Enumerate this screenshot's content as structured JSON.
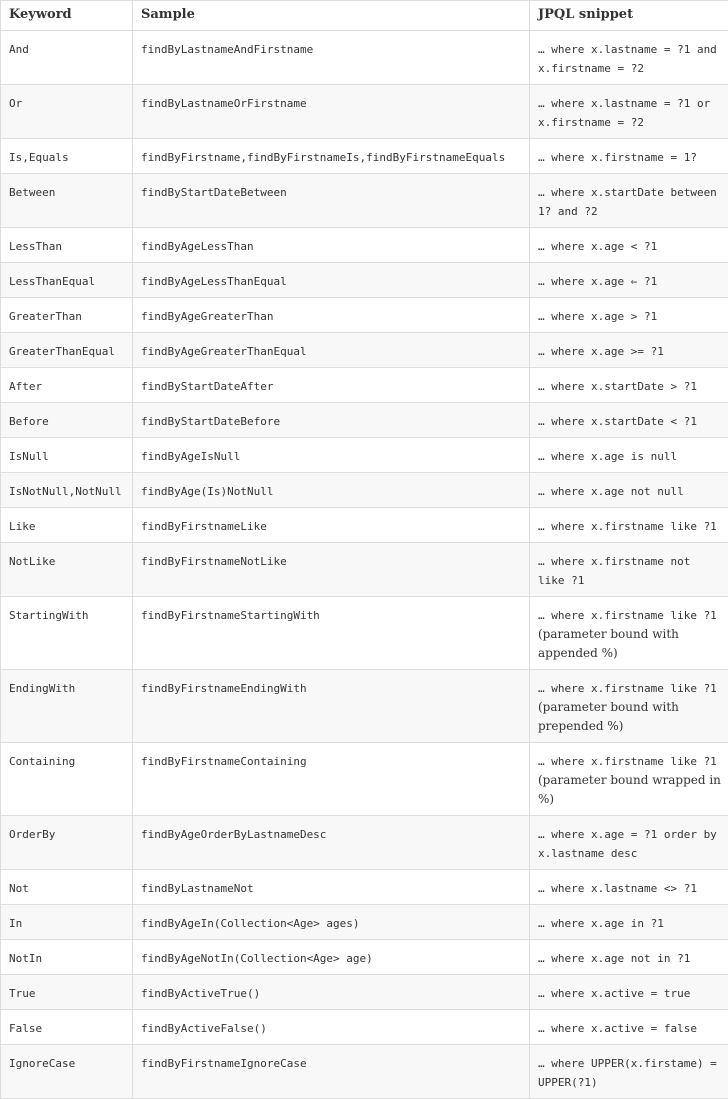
{
  "headers": {
    "keyword": "Keyword",
    "sample": "Sample",
    "jpql": "JPQL snippet"
  },
  "rows": [
    {
      "keyword": "And",
      "sample": "findByLastnameAndFirstname",
      "jpql": "… where x.lastname = ?1 and x.firstname = ?2"
    },
    {
      "keyword": "Or",
      "sample": "findByLastnameOrFirstname",
      "jpql": "… where x.lastname = ?1 or x.firstname = ?2"
    },
    {
      "keyword": "Is,Equals",
      "sample": "findByFirstname,findByFirstnameIs,findByFirstnameEquals",
      "jpql": "… where x.firstname = 1?"
    },
    {
      "keyword": "Between",
      "sample": "findByStartDateBetween",
      "jpql": "… where x.startDate between 1? and ?2"
    },
    {
      "keyword": "LessThan",
      "sample": "findByAgeLessThan",
      "jpql": "… where x.age < ?1"
    },
    {
      "keyword": "LessThanEqual",
      "sample": "findByAgeLessThanEqual",
      "jpql": "… where x.age ⇐ ?1"
    },
    {
      "keyword": "GreaterThan",
      "sample": "findByAgeGreaterThan",
      "jpql": "… where x.age > ?1"
    },
    {
      "keyword": "GreaterThanEqual",
      "sample": "findByAgeGreaterThanEqual",
      "jpql": "… where x.age >= ?1"
    },
    {
      "keyword": "After",
      "sample": "findByStartDateAfter",
      "jpql": "… where x.startDate > ?1"
    },
    {
      "keyword": "Before",
      "sample": "findByStartDateBefore",
      "jpql": "… where x.startDate < ?1"
    },
    {
      "keyword": "IsNull",
      "sample": "findByAgeIsNull",
      "jpql": "… where x.age is null"
    },
    {
      "keyword": "IsNotNull,NotNull",
      "sample": "findByAge(Is)NotNull",
      "jpql": "… where x.age not null"
    },
    {
      "keyword": "Like",
      "sample": "findByFirstnameLike",
      "jpql": "… where x.firstname like ?1"
    },
    {
      "keyword": "NotLike",
      "sample": "findByFirstnameNotLike",
      "jpql": "… where x.firstname not like ?1"
    },
    {
      "keyword": "StartingWith",
      "sample": "findByFirstnameStartingWith",
      "jpql": "… where x.firstname like ?1",
      "note": "(parameter bound with appended %)"
    },
    {
      "keyword": "EndingWith",
      "sample": "findByFirstnameEndingWith",
      "jpql": "… where x.firstname like ?1",
      "note": "(parameter bound with prepended %)"
    },
    {
      "keyword": "Containing",
      "sample": "findByFirstnameContaining",
      "jpql": "… where x.firstname like ?1",
      "note": "(parameter bound wrapped in %)"
    },
    {
      "keyword": "OrderBy",
      "sample": "findByAgeOrderByLastnameDesc",
      "jpql": "… where x.age = ?1 order by x.lastname desc"
    },
    {
      "keyword": "Not",
      "sample": "findByLastnameNot",
      "jpql": "… where x.lastname <> ?1"
    },
    {
      "keyword": "In",
      "sample": "findByAgeIn(Collection<Age> ages)",
      "jpql": "… where x.age in ?1"
    },
    {
      "keyword": "NotIn",
      "sample": "findByAgeNotIn(Collection<Age> age)",
      "jpql": "… where x.age not in ?1"
    },
    {
      "keyword": "True",
      "sample": "findByActiveTrue()",
      "jpql": "… where x.active = true"
    },
    {
      "keyword": "False",
      "sample": "findByActiveFalse()",
      "jpql": "… where x.active = false"
    },
    {
      "keyword": "IgnoreCase",
      "sample": "findByFirstnameIgnoreCase",
      "jpql": "… where UPPER(x.firstame) = UPPER(?1)"
    }
  ]
}
